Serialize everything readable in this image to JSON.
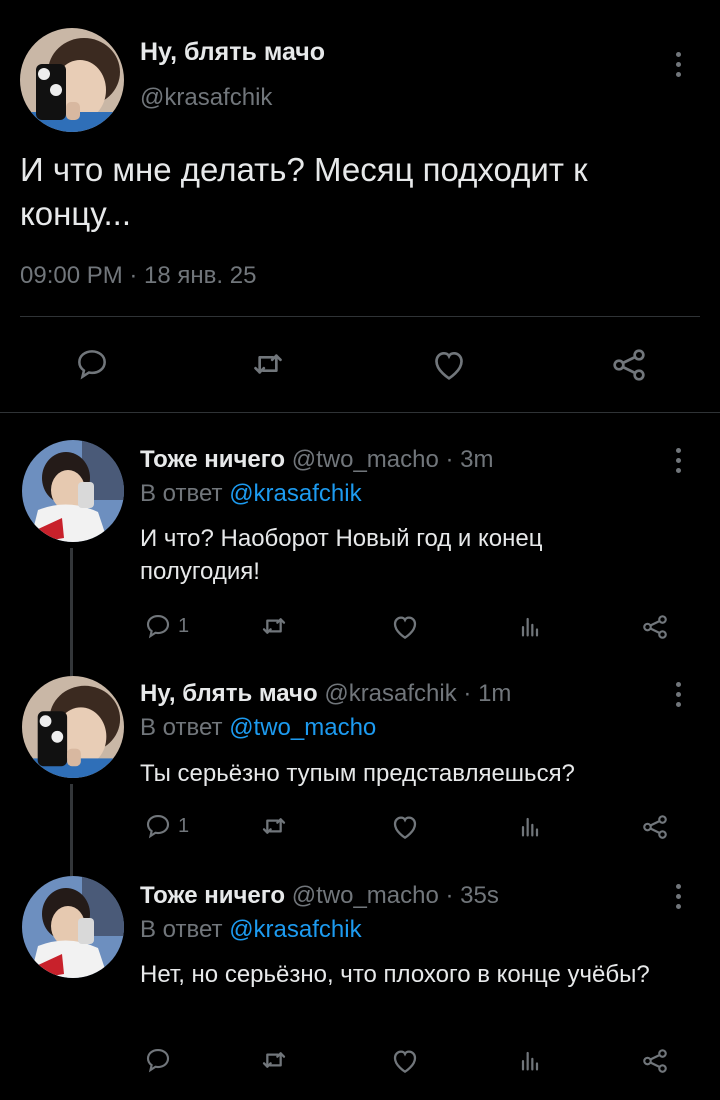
{
  "main_tweet": {
    "display_name": "Ну, блять мачо",
    "handle": "@krasafchik",
    "text": "И что мне делать? Месяц подходит к концу...",
    "timestamp": "09:00 PM · 18 янв. 25",
    "actions": [
      "reply-icon",
      "retweet-icon",
      "like-icon",
      "share-icon"
    ]
  },
  "replies": [
    {
      "display_name": "Тоже ничего",
      "handle": "@two_macho",
      "time": "· 3m",
      "reply_to_label": "В ответ",
      "reply_to": "@krasafchik",
      "text": "И что? Наоборот Новый год и конец полугодия!",
      "reply_count": "1"
    },
    {
      "display_name": "Ну, блять мачо",
      "handle": "@krasafchik",
      "time": "· 1m",
      "reply_to_label": "В ответ",
      "reply_to": "@two_macho",
      "text": "Ты серьёзно тупым представляешься?",
      "reply_count": "1"
    },
    {
      "display_name": "Тоже ничего",
      "handle": "@two_macho",
      "time": "· 35s",
      "reply_to_label": "В ответ",
      "reply_to": "@krasafchik",
      "text": "Нет, но серьёзно, что плохого в конце учёбы?",
      "reply_count": ""
    }
  ],
  "colors": {
    "background": "#000000",
    "text": "#e7e9ea",
    "muted": "#71767b",
    "link": "#1d9bf0",
    "divider": "#2f3336"
  }
}
